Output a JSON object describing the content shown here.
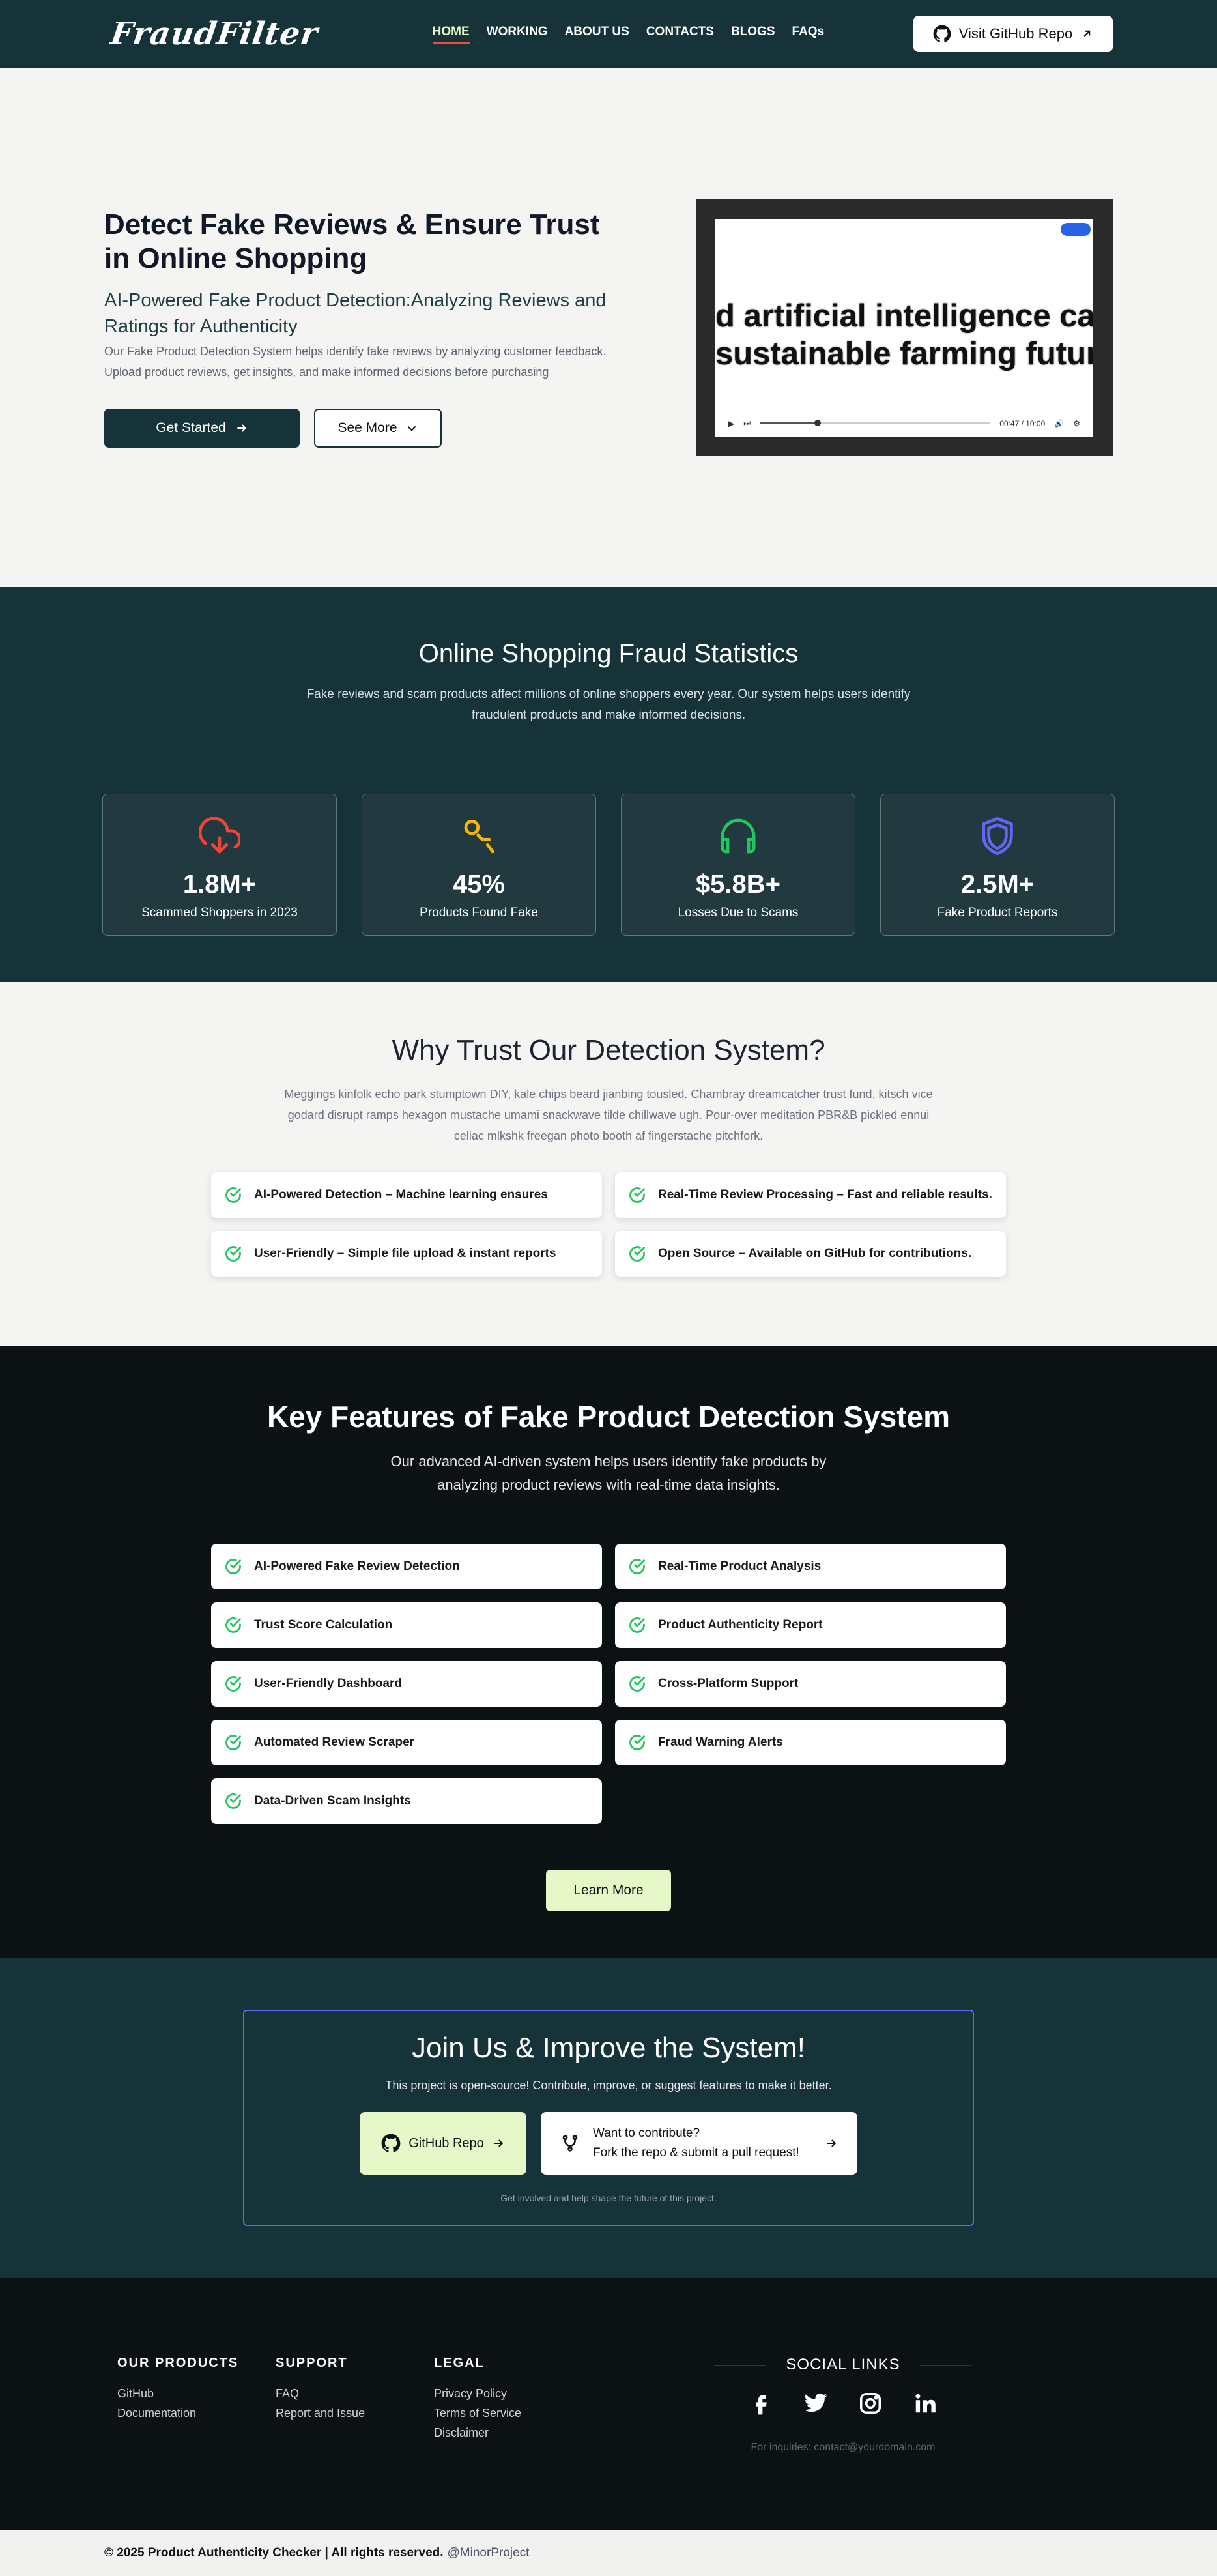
{
  "nav": {
    "logo": "FraudFilter",
    "links": [
      "HOME",
      "WORKING",
      "ABOUT US",
      "CONTACTS",
      "BLOGS",
      "FAQs"
    ],
    "github_button": "Visit GitHub Repo"
  },
  "hero": {
    "title": "Detect Fake Reviews & Ensure Trust in Online Shopping",
    "subtitle": "AI-Powered Fake Product Detection:Analyzing Reviews and Ratings for Authenticity",
    "description": "Our Fake Product Detection System helps identify fake reviews by analyzing customer feedback. Upload product reviews, get insights, and make informed decisions before purchasing",
    "get_started": "Get Started",
    "see_more": "See More",
    "video": {
      "caption_line1": "d artificial intelligence ca",
      "caption_line2": "sustainable farming futur",
      "time": "00:47 / 10:00",
      "progress": 0.25
    }
  },
  "stats": {
    "title": "Online Shopping Fraud Statistics",
    "description": "Fake reviews and scam products affect millions of online shoppers every year. Our system helps users identify fraudulent products and make informed decisions.",
    "cards": [
      {
        "value": "1.8M+",
        "label": "Scammed Shoppers in 2023",
        "icon": "cloud-download-icon",
        "color": "#f04438"
      },
      {
        "value": "45%",
        "label": "Products Found Fake",
        "icon": "users-icon",
        "color": "#f5b50a"
      },
      {
        "value": "$5.8B+",
        "label": "Losses Due to Scams",
        "icon": "headphones-icon",
        "color": "#22c55e"
      },
      {
        "value": "2.5M+",
        "label": "Fake Product Reports",
        "icon": "shield-icon",
        "color": "#6366f1"
      }
    ]
  },
  "why": {
    "title": "Why Trust Our Detection System?",
    "description": "Meggings kinfolk echo park stumptown DIY, kale chips beard jianbing tousled. Chambray dreamcatcher trust fund, kitsch vice godard disrupt ramps hexagon mustache umami snackwave tilde chillwave ugh. Pour-over meditation PBR&B pickled ennui celiac mlkshk freegan photo booth af fingerstache pitchfork.",
    "items": [
      "AI-Powered Detection – Machine learning ensures",
      "Real-Time Review Processing – Fast and reliable results.",
      "User-Friendly – Simple file upload & instant reports",
      "Open Source – Available on GitHub for contributions."
    ]
  },
  "features": {
    "title": "Key Features of Fake Product Detection System",
    "description": "Our advanced AI-driven system helps users identify fake products by analyzing product reviews with real-time data insights.",
    "items": [
      "AI-Powered Fake Review Detection",
      "Real-Time Product Analysis",
      "Trust Score Calculation",
      "Product Authenticity Report",
      "User-Friendly Dashboard",
      "Cross-Platform Support",
      "Automated Review Scraper",
      "Fraud Warning Alerts",
      "Data-Driven Scam Insights"
    ],
    "learn_more": "Learn More"
  },
  "join": {
    "title": "Join Us & Improve the System!",
    "description": "This project is open-source! Contribute, improve, or suggest features to make it better.",
    "github_button": "GitHub Repo",
    "contribute_line1": "Want to contribute?",
    "contribute_line2": "Fork the repo & submit a pull request!",
    "note": "Get involved and help shape the future of this project."
  },
  "footer": {
    "columns": [
      {
        "title": "OUR PRODUCTS",
        "links": [
          "GitHub",
          "Documentation"
        ]
      },
      {
        "title": "SUPPORT",
        "links": [
          "FAQ",
          "Report and Issue"
        ]
      },
      {
        "title": "LEGAL",
        "links": [
          "Privacy Policy",
          "Terms of Service",
          "Disclaimer"
        ]
      }
    ],
    "social_title": "SOCIAL LINKS",
    "social_icons": [
      "facebook-icon",
      "twitter-icon",
      "instagram-icon",
      "linkedin-icon"
    ],
    "inquiries": "For inquiries: contact@yourdomain.com"
  },
  "bottom": {
    "copyright": "© 2025 Product Authenticity Checker | All rights reserved.",
    "handle": "@MinorProject"
  },
  "colors": {
    "primary": "#17333a",
    "accent": "#e7f8c8",
    "dark": "#0c1114",
    "check": "#22c55e"
  }
}
